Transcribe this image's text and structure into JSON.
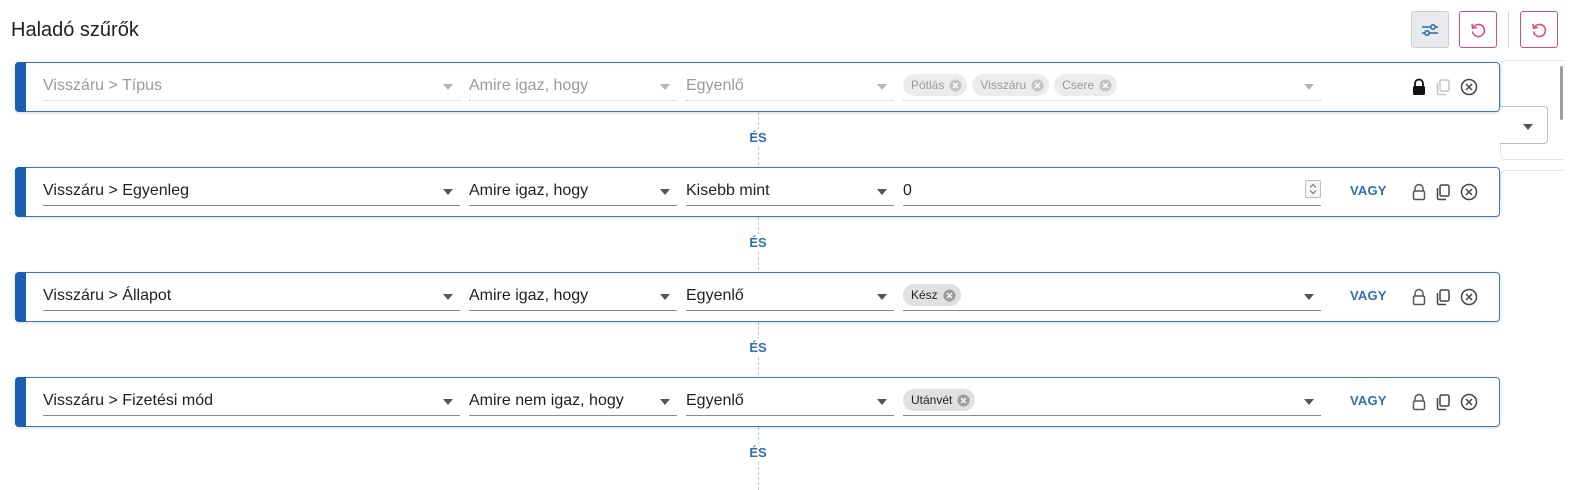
{
  "header": {
    "title": "Haladó szűrők",
    "buttons": [
      {
        "icon": "filter-settings-icon"
      },
      {
        "icon": "reset-icon"
      },
      {
        "icon": "reset-icon"
      }
    ]
  },
  "colors": {
    "accent": "#1a5fb0",
    "link": "#2f6fb3",
    "reset_border": "#e04a7a"
  },
  "connector_label": "ÉS",
  "rows": [
    {
      "field": "Visszáru > Típus",
      "condition": "Amire igaz, hogy",
      "operator": "Egyenlő",
      "values": [
        "Pótlás",
        "Visszáru",
        "Csere"
      ],
      "locked": true,
      "disabled": true
    },
    {
      "field": "Visszáru > Egyenleg",
      "condition": "Amire igaz, hogy",
      "operator": "Kisebb mint",
      "value": "0",
      "or_label": "VAGY",
      "locked": false
    },
    {
      "field": "Visszáru > Állapot",
      "condition": "Amire igaz, hogy",
      "operator": "Egyenlő",
      "values": [
        "Kész"
      ],
      "or_label": "VAGY",
      "locked": false
    },
    {
      "field": "Visszáru > Fizetési mód",
      "condition": "Amire nem igaz, hogy",
      "operator": "Egyenlő",
      "values": [
        "Utánvét"
      ],
      "or_label": "VAGY",
      "locked": false
    }
  ]
}
